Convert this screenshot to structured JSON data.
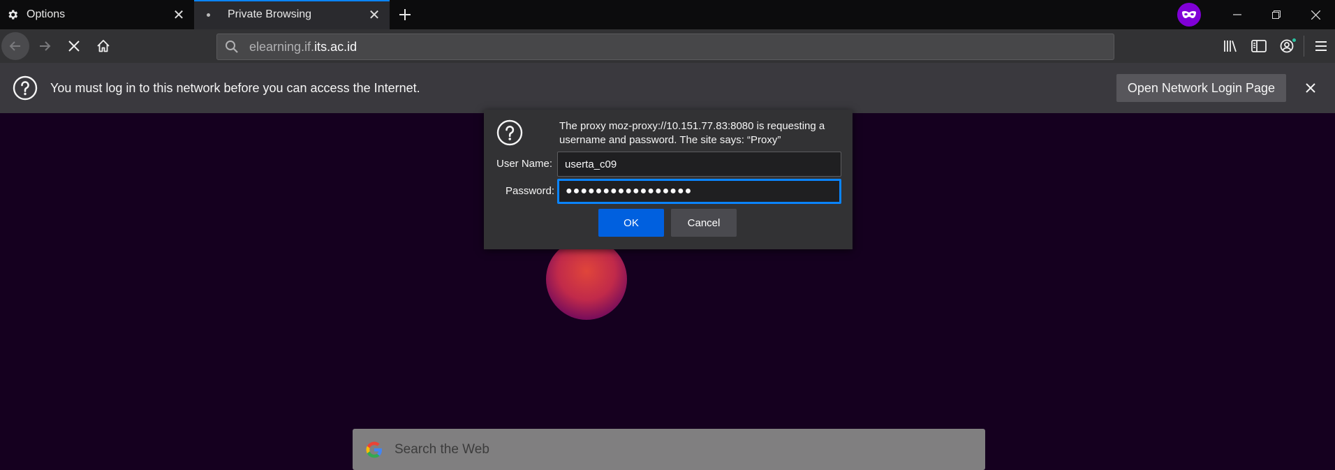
{
  "tabs": [
    {
      "icon": "gear-icon",
      "title": "Options"
    },
    {
      "icon": "dot-icon",
      "title": "Private Browsing",
      "active": true
    }
  ],
  "window_controls": [
    "minimize",
    "restore",
    "close"
  ],
  "navbar": {
    "url": {
      "prefix": "elearning.if.",
      "host": "its.ac.id"
    }
  },
  "notification": {
    "message": "You must log in to this network before you can access the Internet.",
    "button_label": "Open Network Login Page"
  },
  "auth_dialog": {
    "message": "The proxy moz-proxy://10.151.77.83:8080 is requesting a username and password. The site says: “Proxy”",
    "username_label": "User Name:",
    "username_value": "userta_c09",
    "password_label": "Password:",
    "password_masked": "●●●●●●●●●●●●●●●●●",
    "ok_label": "OK",
    "cancel_label": "Cancel"
  },
  "page": {
    "search_placeholder": "Search the Web"
  },
  "colors": {
    "accent": "#0a84ff",
    "private_purple": "#8000d7",
    "page_background": "#15001f"
  }
}
